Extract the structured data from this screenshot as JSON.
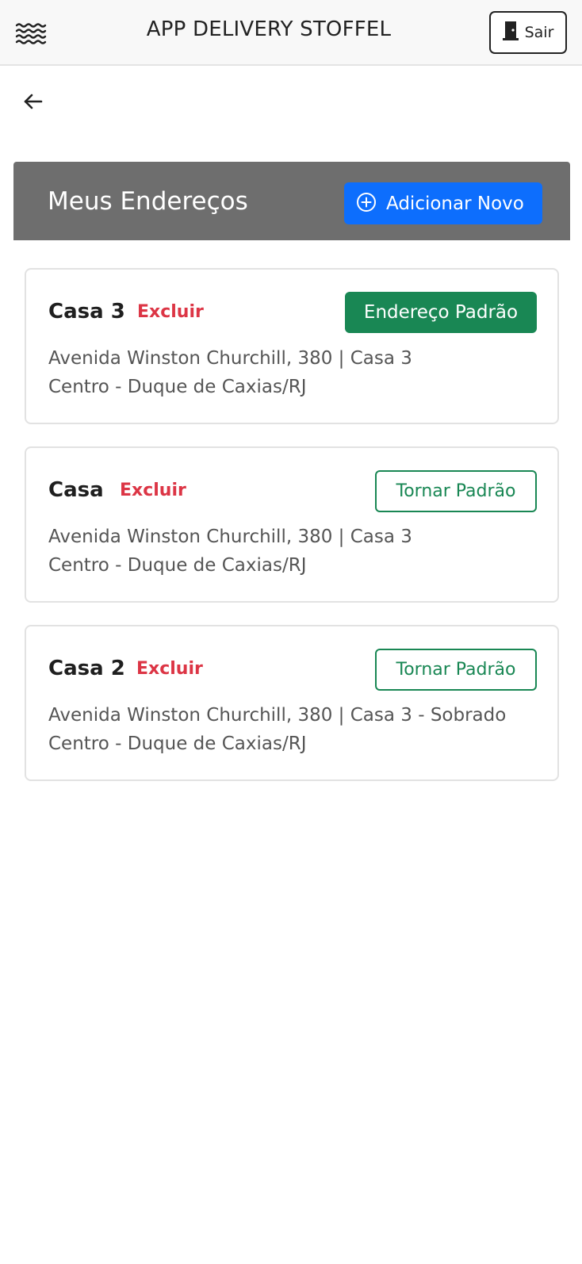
{
  "header": {
    "app_title": "APP DELIVERY STOFFEL",
    "logout_label": "Sair",
    "menu_icon": "menu-waves-icon",
    "logout_icon": "door-icon"
  },
  "nav": {
    "back_icon": "arrow-left-icon"
  },
  "section": {
    "title": "Meus Endereços",
    "add_button_label": "Adicionar Novo",
    "add_icon": "plus-circle-icon"
  },
  "addresses": [
    {
      "name": "Casa 3",
      "delete_label": "Excluir",
      "action_label": "Endereço Padrão",
      "is_default": true,
      "line1": "Avenida Winston Churchill, 380 | Casa 3",
      "line2": "Centro - Duque de Caxias/RJ"
    },
    {
      "name": "Casa",
      "delete_label": "Excluir",
      "action_label": "Tornar Padrão",
      "is_default": false,
      "line1": "Avenida Winston Churchill, 380 | Casa 3",
      "line2": "Centro - Duque de Caxias/RJ"
    },
    {
      "name": "Casa 2",
      "delete_label": "Excluir",
      "action_label": "Tornar Padrão",
      "is_default": false,
      "line1": "Avenida Winston Churchill, 380 | Casa 3 - Sobrado",
      "line2": "Centro - Duque de Caxias/RJ"
    }
  ],
  "colors": {
    "header_bar": "#6e6e6e",
    "primary": "#0d6efd",
    "success": "#198754",
    "danger": "#dc3545"
  }
}
